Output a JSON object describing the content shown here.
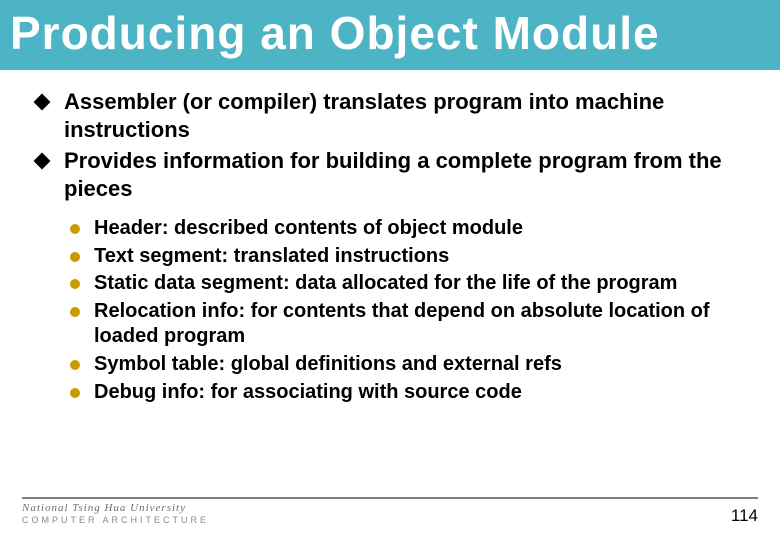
{
  "title": "Producing an Object Module",
  "bullets": [
    {
      "text": "Assembler (or compiler) translates program into machine instructions"
    },
    {
      "text": "Provides information for building a complete program from the pieces"
    }
  ],
  "sub_bullets": [
    {
      "text": "Header: described contents of object module"
    },
    {
      "text": "Text segment: translated instructions"
    },
    {
      "text": "Static data segment: data allocated for the life of the program"
    },
    {
      "text": "Relocation info: for contents that depend on absolute location of loaded program"
    },
    {
      "text": "Symbol table: global definitions and external refs"
    },
    {
      "text": "Debug info: for associating with source code"
    }
  ],
  "footer": {
    "university": "National Tsing Hua University",
    "course": "COMPUTER ARCHITECTURE",
    "page": "114"
  }
}
